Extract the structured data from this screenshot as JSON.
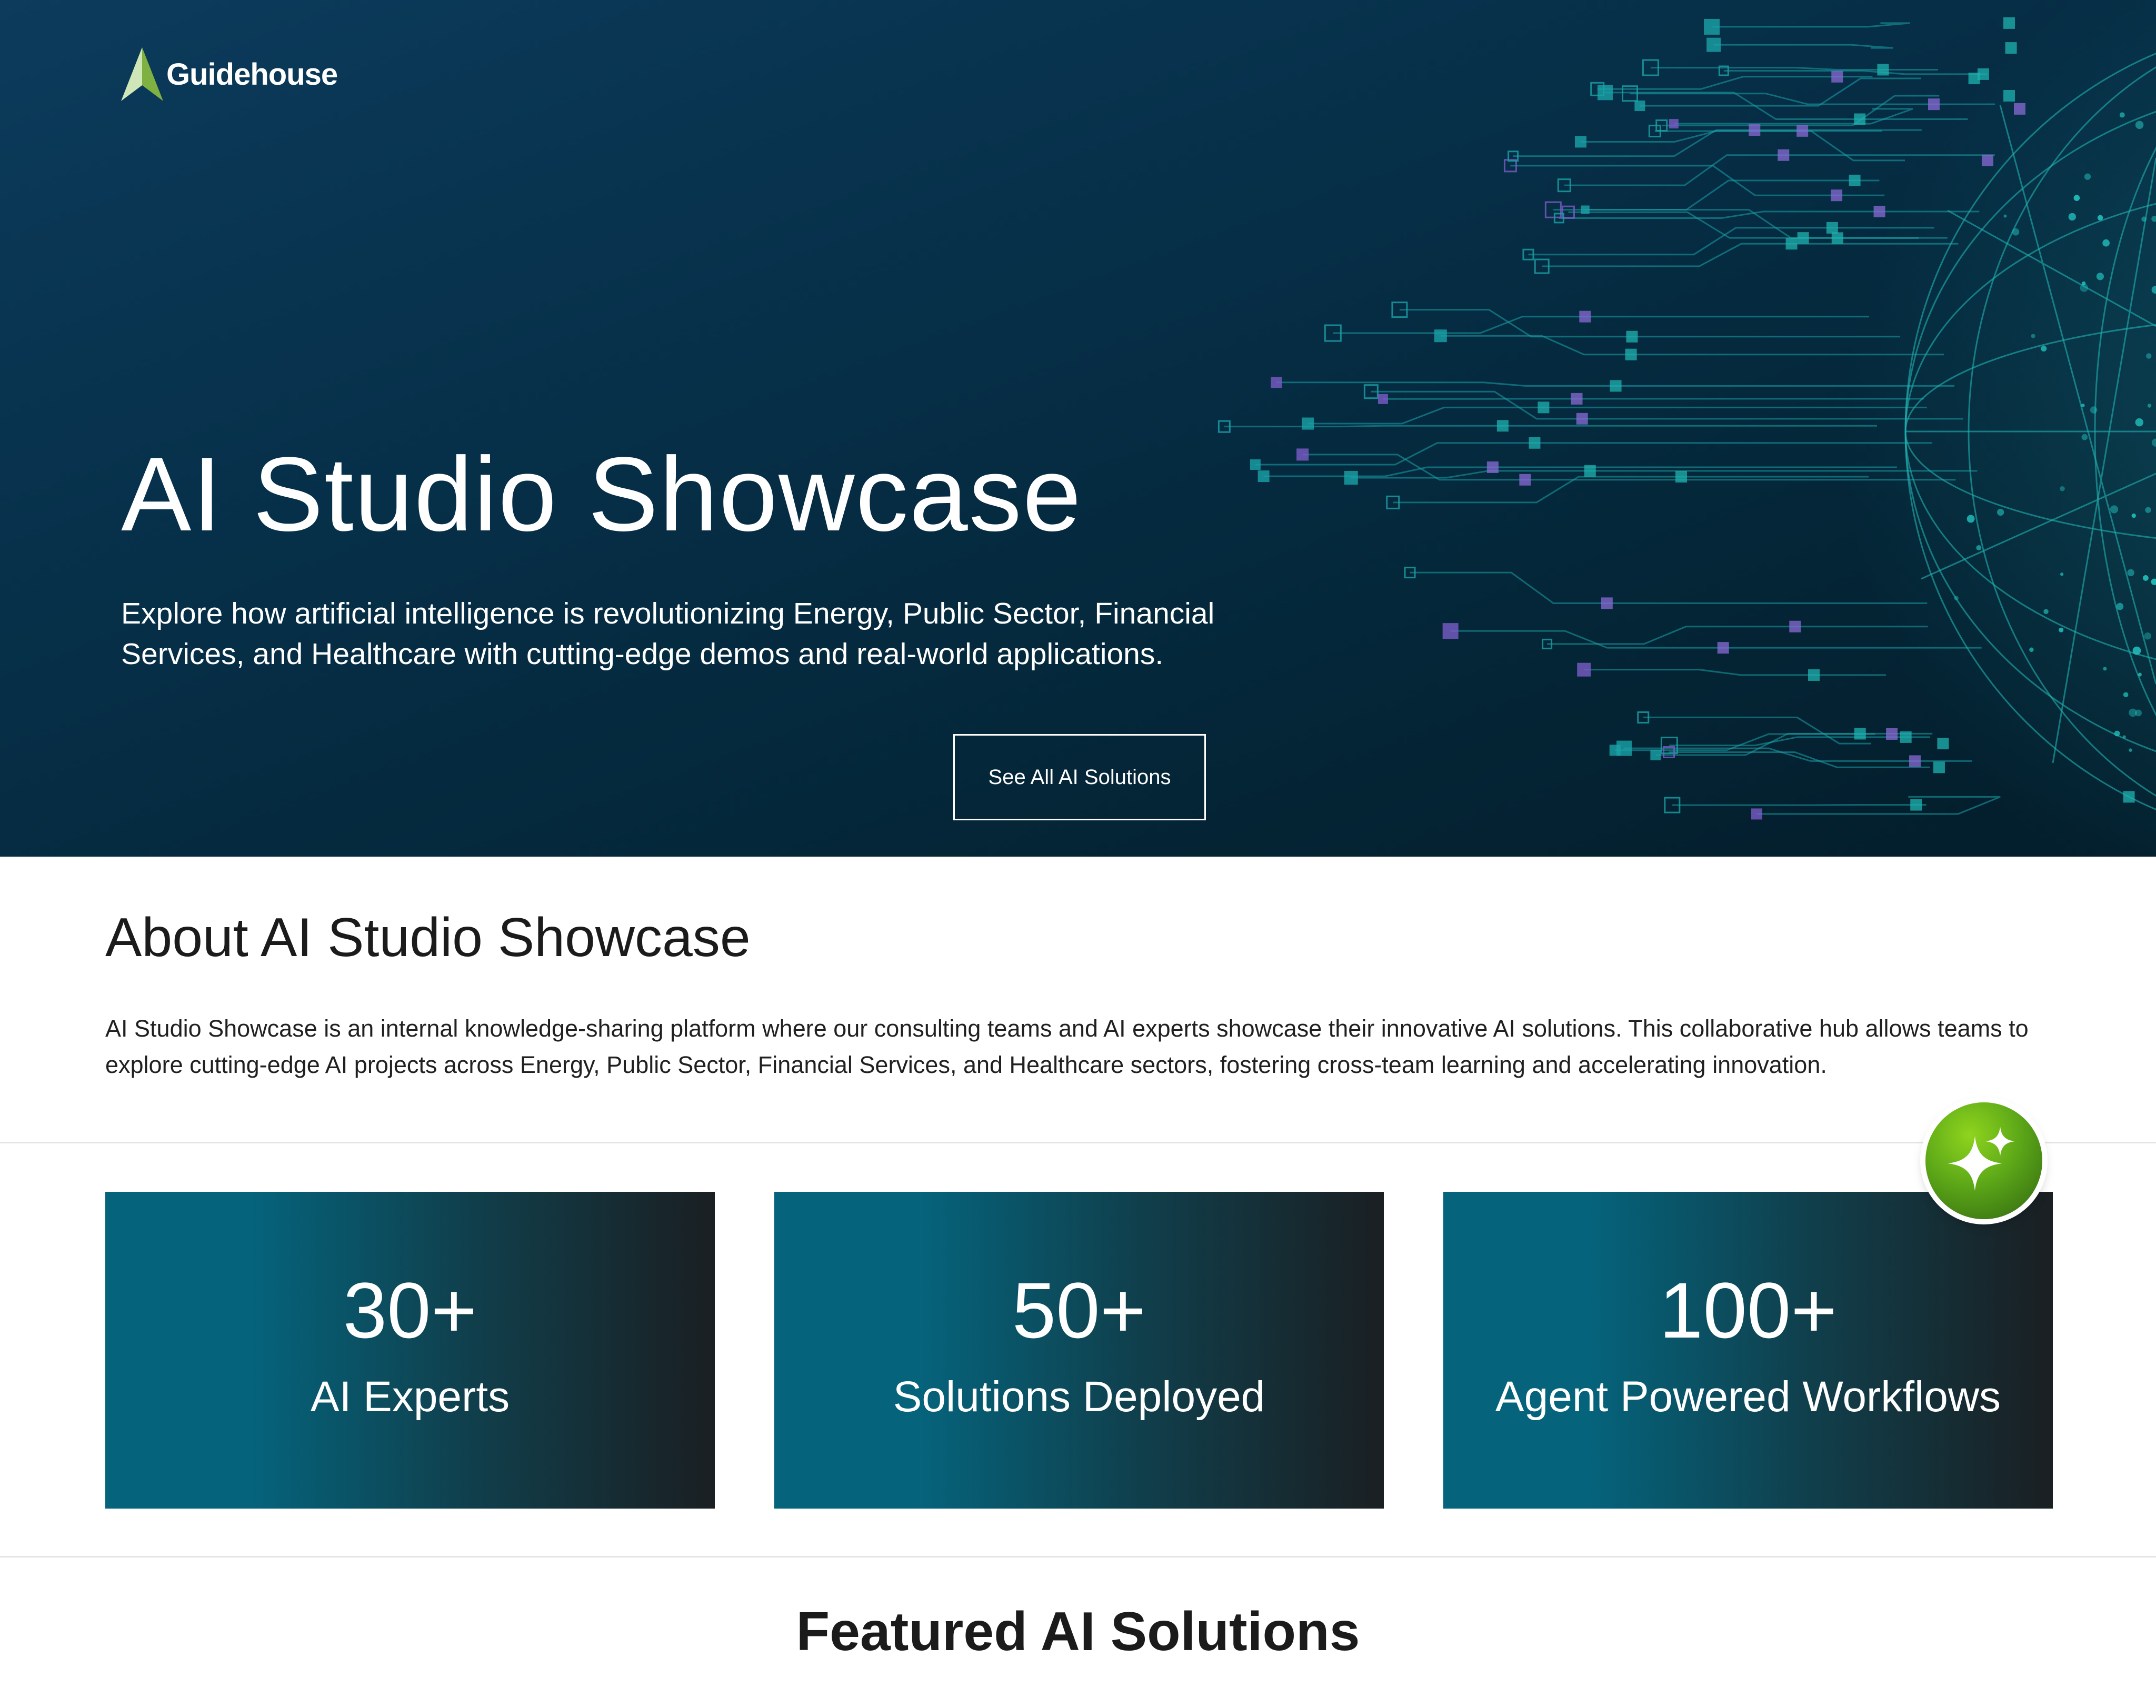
{
  "brand": {
    "name": "Guidehouse",
    "logo_icon": "guidehouse-peak-icon",
    "colors": {
      "hero_dark": "#042536",
      "hero_accent": "#1fb3b0",
      "circuit_purple": "#7b5cc7",
      "stat_teal": "#05637b",
      "stat_dark": "#1a1f22",
      "badge_green": "#6cbf1a"
    }
  },
  "hero": {
    "title": "AI Studio Showcase",
    "subtitle": "Explore how artificial intelligence is revolutionizing Energy, Public Sector, Financial Services, and Healthcare with cutting-edge demos and real-world applications.",
    "cta_label": "See All AI Solutions"
  },
  "about": {
    "title": "About AI Studio Showcase",
    "body": "AI Studio Showcase is an internal knowledge-sharing platform where our consulting teams and AI experts showcase their innovative AI solutions. This collaborative hub allows teams to explore cutting-edge AI projects across Energy, Public Sector, Financial Services, and Healthcare sectors, fostering cross-team learning and accelerating innovation."
  },
  "stats": [
    {
      "value": "30+",
      "label": "AI Experts"
    },
    {
      "value": "50+",
      "label": "Solutions Deployed"
    },
    {
      "value": "100+",
      "label": "Agent Powered Workflows"
    }
  ],
  "assistant_badge": {
    "icon": "sparkle-icon"
  },
  "featured": {
    "title": "Featured AI Solutions"
  }
}
